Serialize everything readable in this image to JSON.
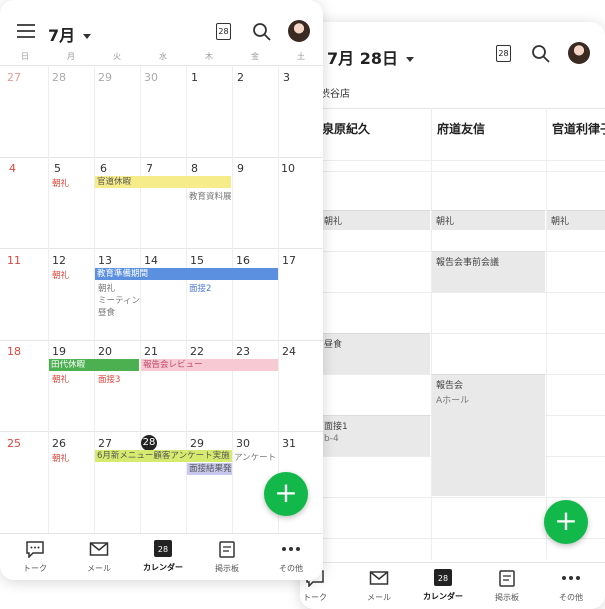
{
  "day_view": {
    "title": "7月 28日",
    "calendar_icon_day": "28",
    "store": "渋谷店",
    "columns": [
      "泉原紀久",
      "府道友信",
      "官道利律子"
    ],
    "events": [
      {
        "col": 0,
        "title": "朝礼"
      },
      {
        "col": 1,
        "title": "朝礼"
      },
      {
        "col": 2,
        "title": "朝礼"
      },
      {
        "col": 1,
        "title": "報告会事前会議"
      },
      {
        "col": 0,
        "title": "昼食"
      },
      {
        "col": 1,
        "title": "報告会",
        "sub": "Aホール"
      },
      {
        "col": 0,
        "title": "面接1",
        "sub": "b-4"
      }
    ],
    "fab": "+",
    "tabs": [
      {
        "label": "トーク",
        "icon": "chat-icon"
      },
      {
        "label": "メール",
        "icon": "mail-icon"
      },
      {
        "label": "カレンダー",
        "icon": "calendar-icon",
        "day": "28",
        "active": true
      },
      {
        "label": "掲示板",
        "icon": "board-icon"
      },
      {
        "label": "その他",
        "icon": "more-icon"
      }
    ]
  },
  "month_view": {
    "title": "7月",
    "calendar_icon_day": "28",
    "weekdays": [
      "日",
      "月",
      "火",
      "水",
      "木",
      "金",
      "土"
    ],
    "weeks": [
      [
        "27",
        "28",
        "29",
        "30",
        "1",
        "2",
        "3"
      ],
      [
        "4",
        "5",
        "6",
        "7",
        "8",
        "9",
        "10"
      ],
      [
        "11",
        "12",
        "13",
        "14",
        "15",
        "16",
        "17"
      ],
      [
        "18",
        "19",
        "20",
        "21",
        "22",
        "23",
        "24"
      ],
      [
        "25",
        "26",
        "27",
        "28",
        "29",
        "30",
        "31"
      ]
    ],
    "events": {
      "w1_chourei": "朝礼",
      "w1_bar": "官道休暇",
      "w1_kyouiku": "教育資料展",
      "w2_chourei": "朝礼",
      "w2_bar": "教育準備期間",
      "w2_chourei2": "朝礼",
      "w2_meeting": "ミーティン",
      "w2_lunch": "昼食",
      "w2_mensetsu": "面接2",
      "w3_bar1": "田代休暇",
      "w3_chourei": "朝礼",
      "w3_mensetsu": "面接3",
      "w3_bar2": "報告会レビュー",
      "w4_chourei": "朝礼",
      "w4_bar1": "6月新メニュー顧客アンケート実施",
      "w4_bar2": "面接結果発",
      "w4_survey": "アンケート"
    },
    "fab": "+",
    "tabs": [
      {
        "label": "トーク",
        "icon": "chat-icon"
      },
      {
        "label": "メール",
        "icon": "mail-icon"
      },
      {
        "label": "カレンダー",
        "icon": "calendar-icon",
        "day": "28",
        "active": true
      },
      {
        "label": "掲示板",
        "icon": "board-icon"
      },
      {
        "label": "その他",
        "icon": "more-icon"
      }
    ]
  },
  "colors": {
    "accent_green": "#12b84a",
    "sunday_red": "#e0453a",
    "bar_yellow": "#f7ec8a",
    "bar_blue": "#5b8fe0",
    "bar_green": "#4caf50",
    "bar_pink": "#f7c9d2",
    "bar_lime": "#d6ea6f",
    "bar_lavender": "#c9c9ef"
  }
}
